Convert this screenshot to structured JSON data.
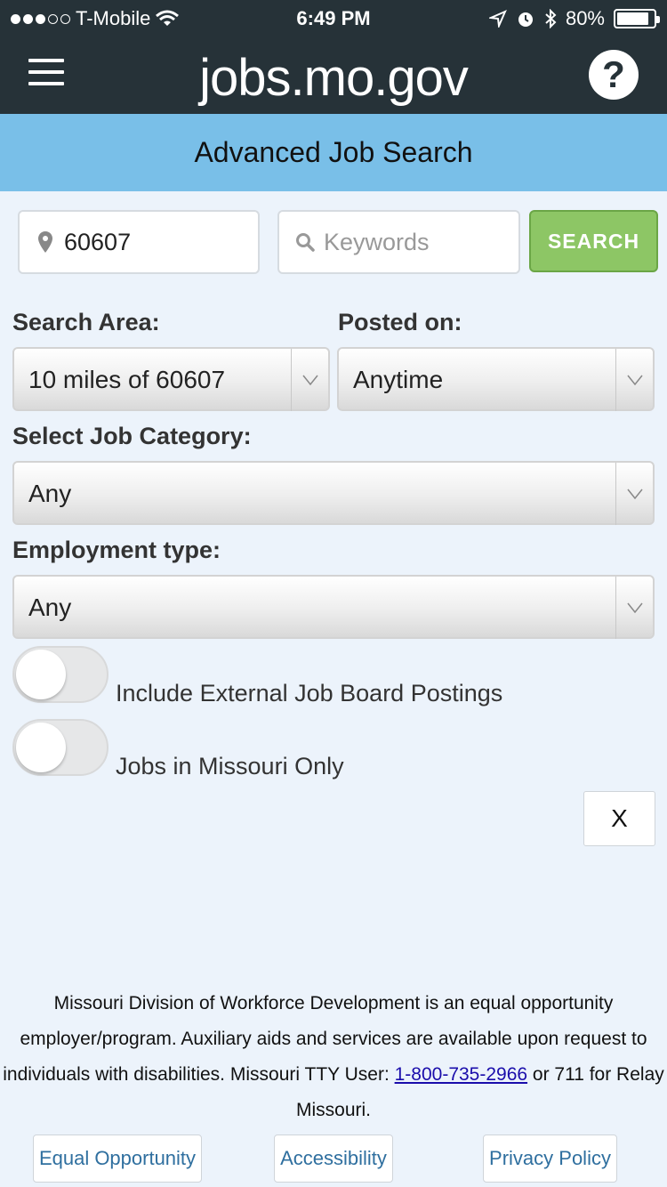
{
  "status_bar": {
    "carrier": "T-Mobile",
    "time": "6:49 PM",
    "battery": "80%",
    "signal_bars_filled": 3,
    "signal_bars_total": 5
  },
  "header": {
    "logo": "jobs.mo.gov",
    "help_label": "?"
  },
  "title": "Advanced Job Search",
  "search": {
    "zip_value": "60607",
    "keywords_placeholder": "Keywords",
    "search_button": "SEARCH"
  },
  "filters": {
    "search_area_label": "Search Area:",
    "search_area_value": "10 miles of 60607",
    "posted_on_label": "Posted on:",
    "posted_on_value": "Anytime",
    "category_label": "Select Job Category:",
    "category_value": "Any",
    "employment_label": "Employment type:",
    "employment_value": "Any"
  },
  "toggles": {
    "external_label": "Include External Job Board Postings",
    "external_on": false,
    "missouri_label": "Jobs in Missouri Only",
    "missouri_on": false
  },
  "close_label": "X",
  "footer": {
    "text_before": "Missouri Division of Workforce Development is an equal opportunity employer/program. Auxiliary aids and services are available upon request to individuals with disabilities. Missouri TTY User: ",
    "phone": "1-800-735-2966",
    "text_after": " or 711 for Relay Missouri.",
    "links": [
      "Equal Opportunity",
      "Accessibility",
      "Privacy Policy"
    ]
  },
  "colors": {
    "header_bg": "#263238",
    "title_bar_bg": "#79bfe8",
    "search_button_bg": "#8dc665",
    "link_color": "#2f6f9f"
  }
}
